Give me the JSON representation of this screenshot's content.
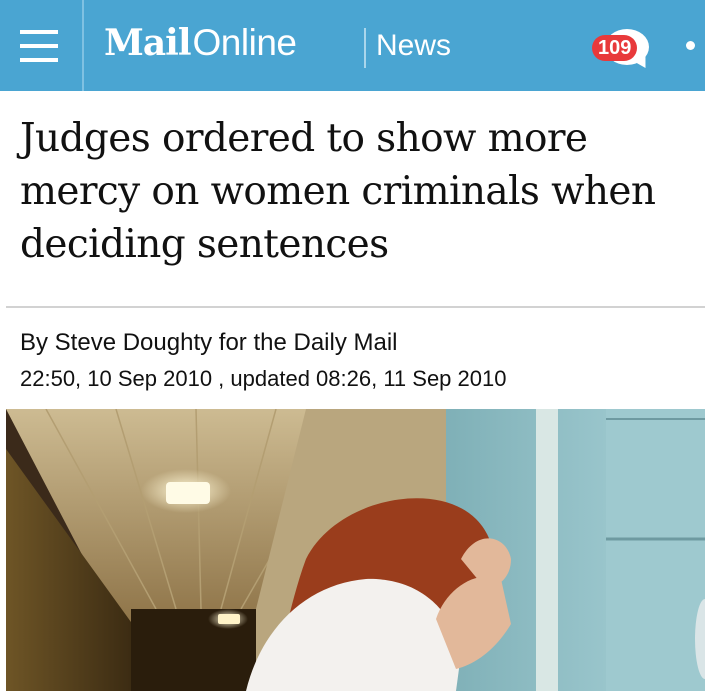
{
  "header": {
    "brand_mail": "Mail",
    "brand_online": "Online",
    "section": "News",
    "comment_count": "109",
    "colors": {
      "bar": "#4aa5d2",
      "badge": "#e8393b"
    },
    "icons": [
      "menu-icon",
      "comment-bubble-icon",
      "more-icon"
    ]
  },
  "article": {
    "headline": "Judges ordered to show more mercy on women criminals when deciding sentences",
    "byline": "By Steve Doughty for the Daily Mail",
    "published": "22:50, 10 Sep 2010",
    "updated_prefix": " , updated ",
    "updated": "08:26, 11 Sep 2010"
  }
}
